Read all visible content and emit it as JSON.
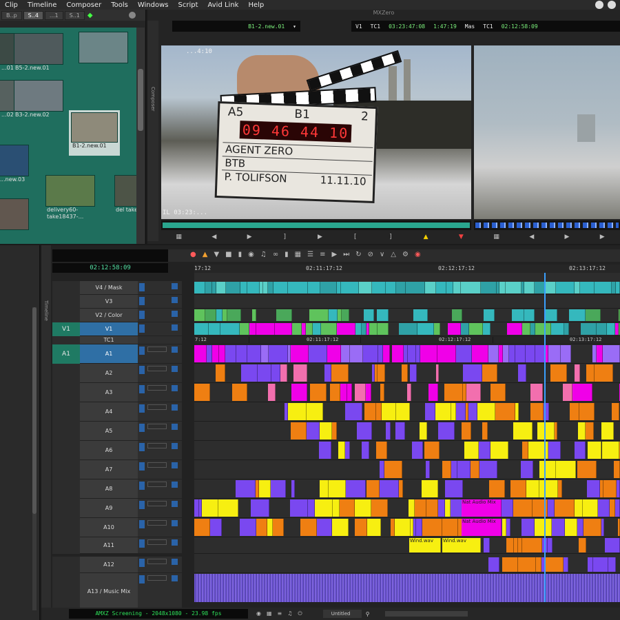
{
  "menu": [
    "Clip",
    "Timeline",
    "Composer",
    "Tools",
    "Windows",
    "Script",
    "Avid Link",
    "Help"
  ],
  "bin": {
    "tabs": [
      "B..p",
      "S..4",
      "...1",
      "S..1"
    ],
    "frames": [
      {
        "label": "...01",
        "color": "#3c4a45"
      },
      {
        "label": "B5-2.new.01",
        "color": "#4f5a5c"
      },
      {
        "label": "",
        "color": "#6b8587"
      },
      {
        "label": "...02",
        "color": "#56615f"
      },
      {
        "label": "B3-2.new.02",
        "color": "#6e7a80"
      },
      {
        "label": "B1-2.new.01",
        "color": "#8e8a7a"
      },
      {
        "label": "...new.03",
        "color": "#2a4f73"
      },
      {
        "label": "delivery60-take18437-...",
        "color": "#5b7a4a"
      },
      {
        "label": "del take18...",
        "color": "#4d5447"
      },
      {
        "label": "...",
        "color": "#61574f"
      }
    ]
  },
  "composer": {
    "title": "MXZero",
    "side_label": "Composer",
    "source_clip": "B1-2.new.01",
    "v1_label": "V1",
    "tc1_label": "TC1",
    "tc1_value": "03:23:47:08",
    "duration": "1:47:19",
    "mas_label": "Mas",
    "mas_tc_label": "TC1",
    "mas_value": "02:12:58:09",
    "overlay_top": "...4:10",
    "overlay_bottom": "IL 03:23:...",
    "slate": {
      "scene": "A5",
      "take_roll": "B1",
      "take": "2",
      "timecode": "09 46 44 10",
      "production": "AGENT ZERO",
      "director": "BTB",
      "camera": "P. TOLIFSON",
      "date": "11.11.10"
    }
  },
  "timeline": {
    "side_label": "Timeline",
    "master_tc": "02:12:58:09",
    "ruler_top": [
      "17:12",
      "02:11:17:12",
      "02:12:17:12",
      "02:13:17:12"
    ],
    "ruler_mid": [
      "7:12",
      "02:11:17:12",
      "02:12:17:12",
      "02:13:17:12"
    ],
    "tracks": [
      {
        "name": "V4 / Mask",
        "type": "video"
      },
      {
        "name": "V3",
        "type": "video"
      },
      {
        "name": "V2 / Color",
        "type": "video"
      },
      {
        "name": "V1",
        "type": "video",
        "selected": true,
        "monitor": "V1"
      },
      {
        "name": "TC1",
        "type": "tc"
      },
      {
        "name": "A1",
        "type": "audio",
        "selected": true,
        "monitor": "A1"
      },
      {
        "name": "A2",
        "type": "audio"
      },
      {
        "name": "A3",
        "type": "audio"
      },
      {
        "name": "A4",
        "type": "audio"
      },
      {
        "name": "A5",
        "type": "audio"
      },
      {
        "name": "A6",
        "type": "audio"
      },
      {
        "name": "A7",
        "type": "audio"
      },
      {
        "name": "A8",
        "type": "audio"
      },
      {
        "name": "A9",
        "type": "audio"
      },
      {
        "name": "A10",
        "type": "audio"
      },
      {
        "name": "A11",
        "type": "audio"
      },
      {
        "name": "A12",
        "type": "audio"
      },
      {
        "name": "A13 / Music Mix",
        "type": "audio"
      }
    ],
    "clip_labels": {
      "wind1": "Wind.wav",
      "wind2": "Wind.wav",
      "nat1": "Nat Audio Mix",
      "nat2": "Nat Audio Mix"
    },
    "colors": {
      "teal": "#35b8bd",
      "green": "#5fc35c",
      "magenta": "#f000e8",
      "purple": "#7a48f0",
      "orange": "#ef7f12",
      "yellow": "#f7ef11",
      "pink": "#f26fae",
      "music": "#5c46c9"
    }
  },
  "status": {
    "format": "AMXZ Screening - 2048x1080 - 23.98 fps",
    "selector": "Untitled"
  }
}
